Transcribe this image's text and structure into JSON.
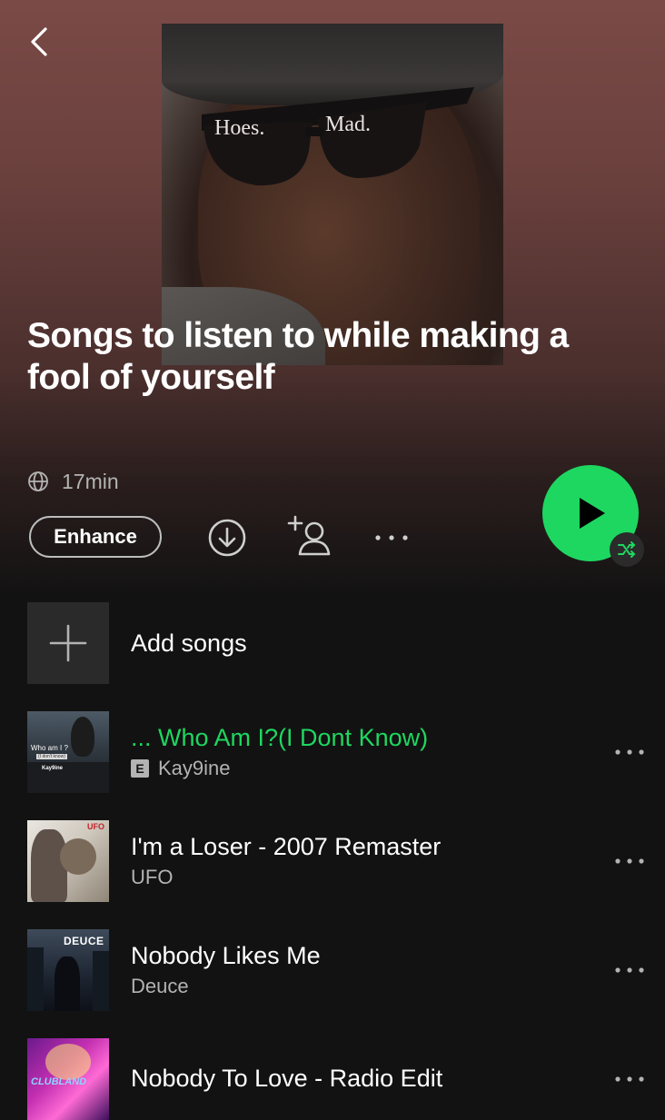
{
  "playlist": {
    "title": "Songs to listen to while making a fool of yourself",
    "duration": "17min",
    "cover_text": {
      "left_lens": "Hoes.",
      "right_lens": "Mad."
    }
  },
  "actions": {
    "enhance_label": "Enhance",
    "download_icon": "download-icon",
    "add_user_icon": "add-user-icon",
    "more_icon": "more-icon",
    "play_icon": "play-icon",
    "shuffle_icon": "shuffle-icon"
  },
  "add_songs": {
    "label": "Add songs",
    "icon": "plus-icon"
  },
  "tracks": [
    {
      "title": "... Who Am I?(I Dont Know)",
      "artist": "Kay9ine",
      "explicit": true,
      "explicit_label": "E",
      "playing": true,
      "art_text": [
        "Who am I ?",
        "(I don't know)",
        "Kay9ine"
      ]
    },
    {
      "title": "I'm a Loser - 2007 Remaster",
      "artist": "UFO",
      "explicit": false,
      "playing": false,
      "art_text": [
        "UFO"
      ]
    },
    {
      "title": "Nobody Likes Me",
      "artist": "Deuce",
      "explicit": false,
      "playing": false,
      "art_text": [
        "DEUCE"
      ]
    },
    {
      "title": "Nobody To Love - Radio Edit",
      "artist": "",
      "explicit": false,
      "playing": false,
      "art_text": [
        "CLUBLAND"
      ]
    }
  ],
  "colors": {
    "accent": "#1ed760",
    "background": "#121212",
    "header_gradient_top": "#7a4a46",
    "secondary_text": "#b3b3b3"
  }
}
